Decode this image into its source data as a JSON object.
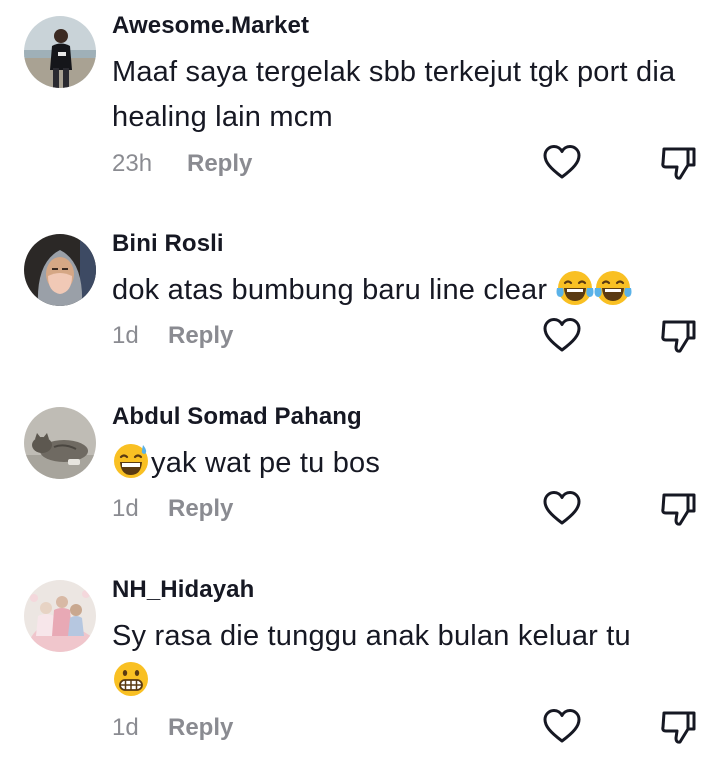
{
  "comments": [
    {
      "author": "Awesome.Market",
      "text": "Maaf saya tergelak sbb terkejut tgk port dia healing lain mcm",
      "time": "23h",
      "reply_label": "Reply",
      "avatar_icon": "avatar-man-beach"
    },
    {
      "author": "Bini Rosli",
      "text": "dok atas bumbung baru line clear",
      "emojis": [
        "laughing-crying-emoji",
        "laughing-crying-emoji"
      ],
      "time": "1d",
      "reply_label": "Reply",
      "avatar_icon": "avatar-woman-hijab-mask"
    },
    {
      "author": "Abdul Somad Pahang",
      "text": "yak wat pe tu bos",
      "leading_emoji": "grinning-sweat-emoji",
      "time": "1d",
      "reply_label": "Reply",
      "avatar_icon": "avatar-cat"
    },
    {
      "author": "NH_Hidayah",
      "text": "Sy rasa die tunggu anak bulan keluar tu",
      "trailing_emoji": "grimacing-emoji",
      "time": "1d",
      "reply_label": "Reply",
      "avatar_icon": "avatar-family-photo"
    }
  ],
  "icons": {
    "like": "heart-outline-icon",
    "dislike": "thumbs-down-outline-icon"
  },
  "colors": {
    "text": "#161823",
    "meta": "#8a8b91",
    "icon": "#161823",
    "emoji_yellow": "#f9c023",
    "tear_blue": "#5ab2e8"
  }
}
